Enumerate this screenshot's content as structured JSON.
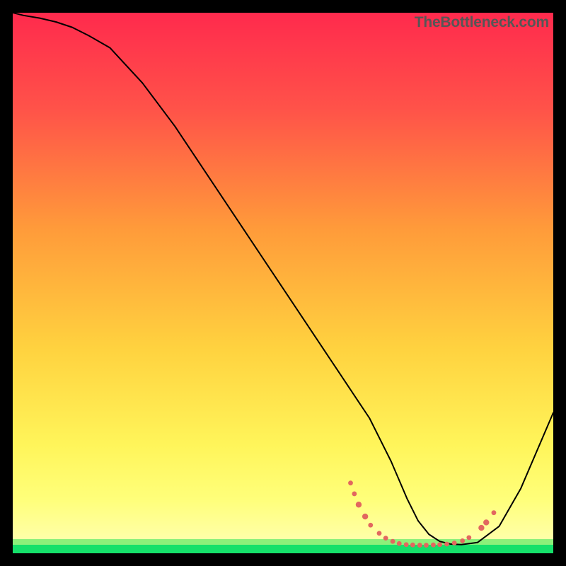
{
  "watermark": "TheBottleneck.com",
  "chart_data": {
    "type": "line",
    "title": "",
    "xlabel": "",
    "ylabel": "",
    "xlim": [
      0,
      100
    ],
    "ylim": [
      0,
      100
    ],
    "grid": false,
    "legend": false,
    "background_gradient": {
      "top_color": "#ff2a4d",
      "mid_color": "#ffd23f",
      "bottom_band_color": "#ffff9a",
      "baseline_color": "#15e06a"
    },
    "series": [
      {
        "name": "bottleneck-curve",
        "x": [
          0,
          2,
          5,
          8,
          11,
          14,
          18,
          24,
          30,
          36,
          42,
          48,
          54,
          60,
          66,
          70,
          73,
          75,
          77,
          79,
          81,
          83,
          86,
          90,
          94,
          100
        ],
        "y": [
          100,
          99.5,
          99,
          98.3,
          97.3,
          95.8,
          93.5,
          87,
          79,
          70,
          61,
          52,
          43,
          34,
          25,
          17,
          10,
          6,
          3.5,
          2.2,
          1.7,
          1.6,
          2,
          5,
          12,
          26
        ],
        "color": "#000000",
        "width": 2
      }
    ],
    "markers": {
      "name": "segment-markers",
      "color": "#e2675f",
      "radius_small": 3.4,
      "radius_large": 4.2,
      "points": [
        {
          "x": 62.5,
          "y": 13.0,
          "r": "small"
        },
        {
          "x": 63.2,
          "y": 11.0,
          "r": "small"
        },
        {
          "x": 64.0,
          "y": 9.0,
          "r": "large"
        },
        {
          "x": 65.2,
          "y": 6.8,
          "r": "large"
        },
        {
          "x": 66.2,
          "y": 5.2,
          "r": "small"
        },
        {
          "x": 67.8,
          "y": 3.7,
          "r": "small"
        },
        {
          "x": 69.0,
          "y": 2.8,
          "r": "small"
        },
        {
          "x": 70.3,
          "y": 2.2,
          "r": "small"
        },
        {
          "x": 71.5,
          "y": 1.8,
          "r": "small"
        },
        {
          "x": 72.8,
          "y": 1.6,
          "r": "small"
        },
        {
          "x": 74.0,
          "y": 1.55,
          "r": "small"
        },
        {
          "x": 75.3,
          "y": 1.5,
          "r": "small"
        },
        {
          "x": 76.5,
          "y": 1.5,
          "r": "small"
        },
        {
          "x": 77.8,
          "y": 1.55,
          "r": "small"
        },
        {
          "x": 79.0,
          "y": 1.6,
          "r": "small"
        },
        {
          "x": 80.3,
          "y": 1.7,
          "r": "small"
        },
        {
          "x": 81.7,
          "y": 1.9,
          "r": "small"
        },
        {
          "x": 83.2,
          "y": 2.3,
          "r": "small"
        },
        {
          "x": 84.4,
          "y": 2.9,
          "r": "small"
        },
        {
          "x": 86.7,
          "y": 4.7,
          "r": "large"
        },
        {
          "x": 87.6,
          "y": 5.7,
          "r": "large"
        },
        {
          "x": 89.0,
          "y": 7.5,
          "r": "small"
        }
      ]
    }
  }
}
